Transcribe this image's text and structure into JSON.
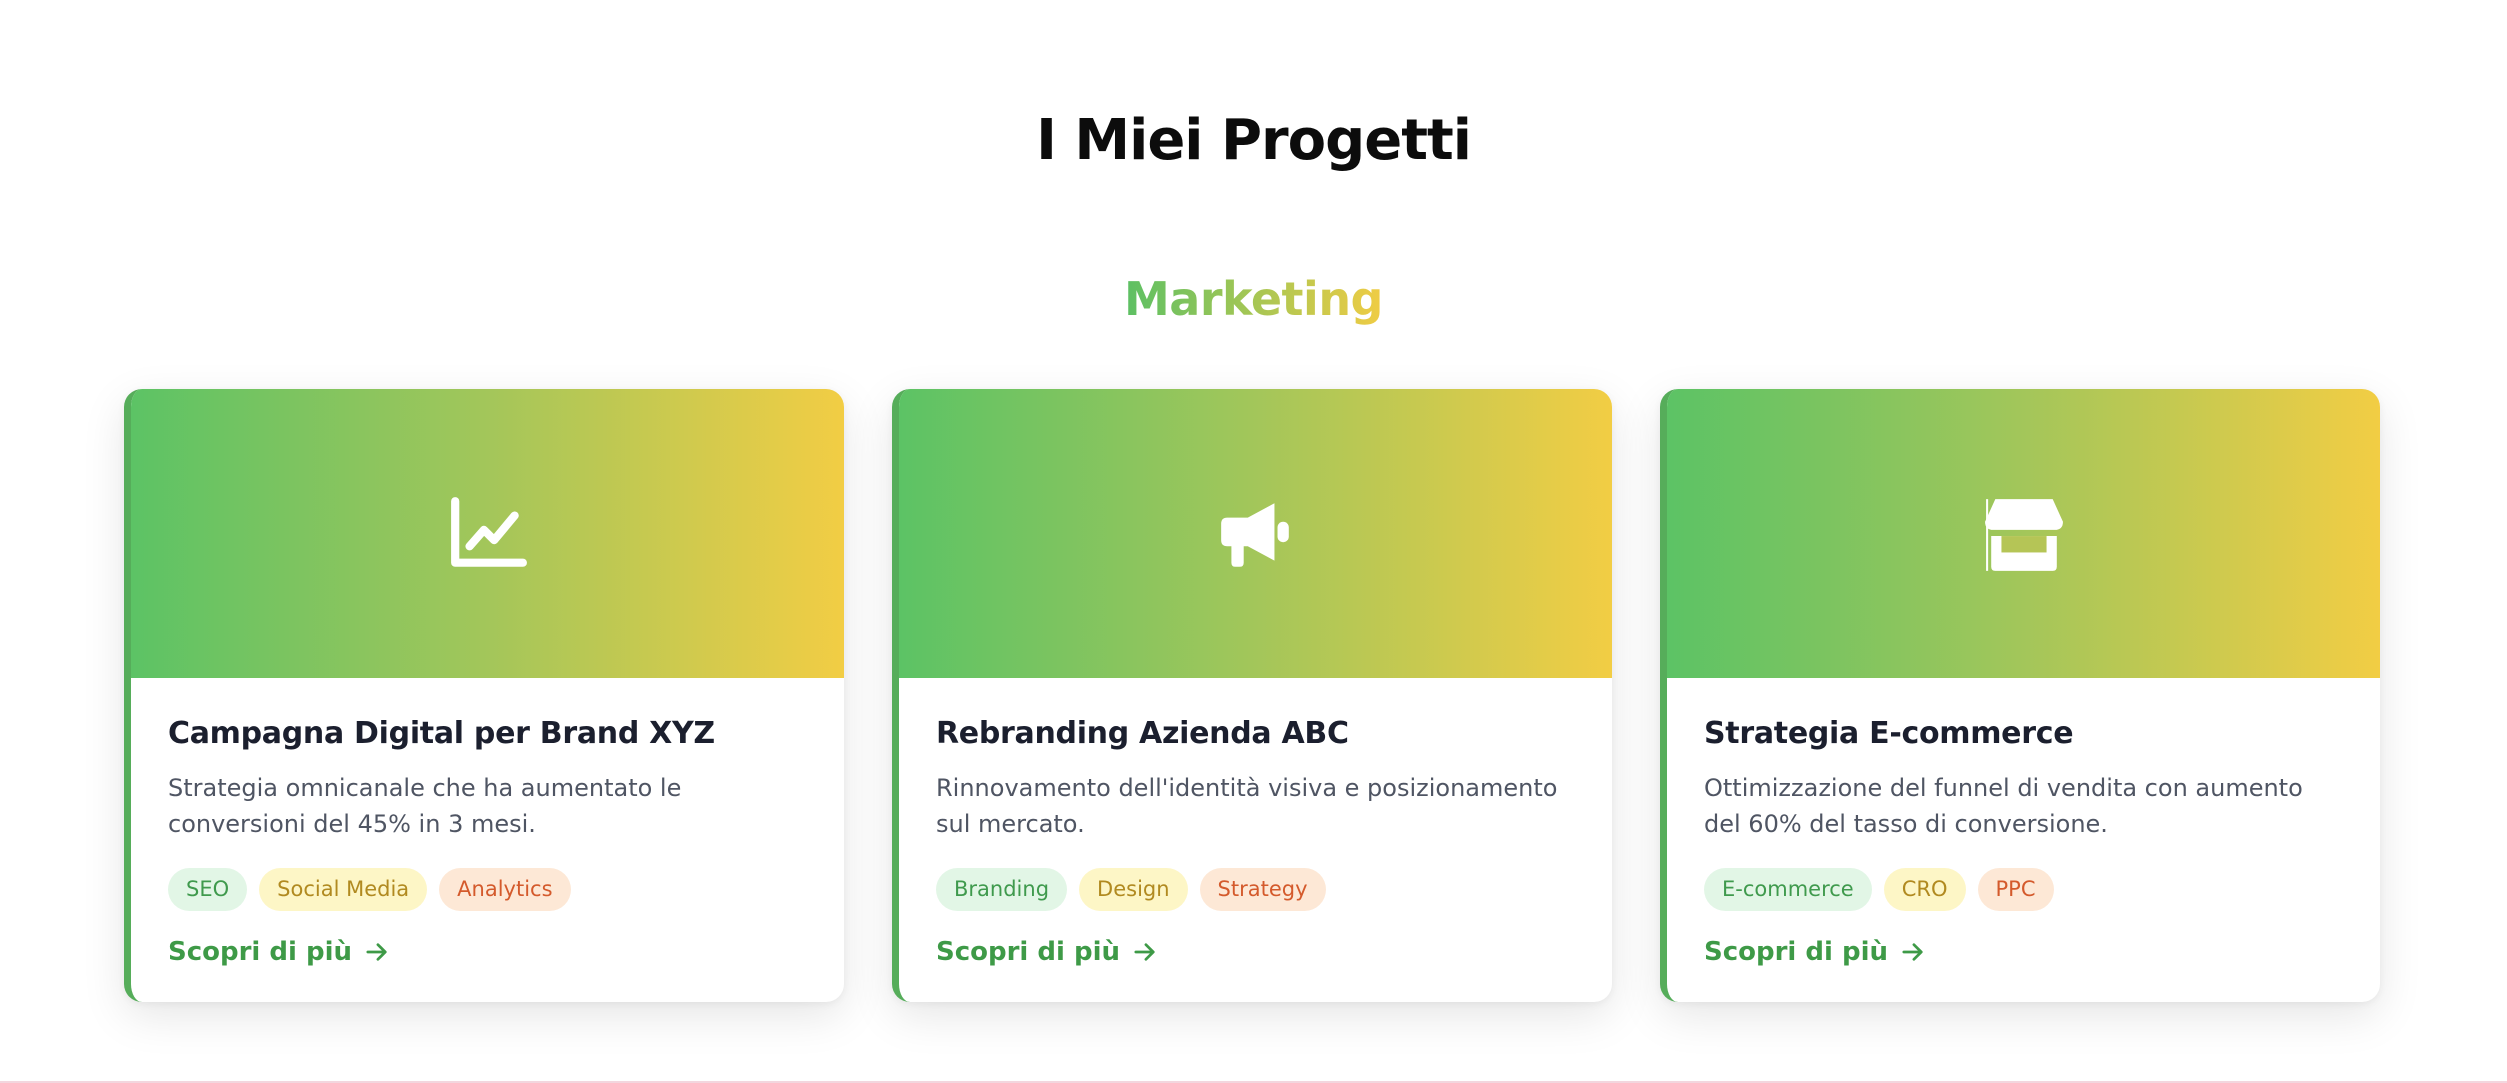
{
  "page": {
    "title": "I Miei Progetti"
  },
  "section": {
    "title": "Marketing"
  },
  "colors": {
    "gradient_start": "#5cc365",
    "gradient_end": "#f2cd44",
    "accent_green": "#3e9a47",
    "tag_green_bg": "#e2f6e6",
    "tag_yellow_bg": "#fdf6c6",
    "tag_orange_bg": "#fde8d6"
  },
  "projects": [
    {
      "icon": "chart-line-icon",
      "title": "Campagna Digital per Brand XYZ",
      "description": "Strategia omnicanale che ha aumentato le conversioni del 45% in 3 mesi.",
      "tags": [
        "SEO",
        "Social Media",
        "Analytics"
      ],
      "link_label": "Scopri di più"
    },
    {
      "icon": "megaphone-icon",
      "title": "Rebranding Azienda ABC",
      "description": "Rinnovamento dell'identità visiva e posizionamento sul mercato.",
      "tags": [
        "Branding",
        "Design",
        "Strategy"
      ],
      "link_label": "Scopri di più"
    },
    {
      "icon": "store-icon",
      "title": "Strategia E-commerce",
      "description": "Ottimizzazione del funnel di vendita con aumento del 60% del tasso di conversione.",
      "tags": [
        "E-commerce",
        "CRO",
        "PPC"
      ],
      "link_label": "Scopri di più"
    }
  ]
}
